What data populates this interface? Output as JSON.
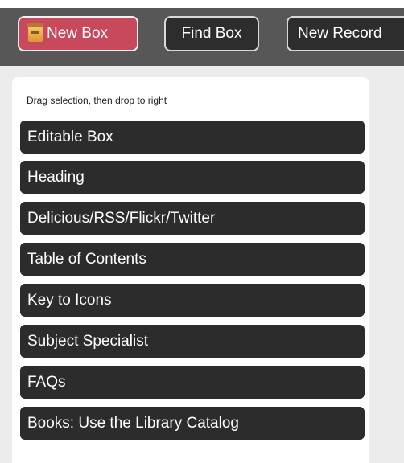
{
  "toolbar": {
    "new_box_label": "New Box",
    "new_box_icon": "box-icon",
    "find_box_label": "Find Box",
    "new_record_label": "New Record"
  },
  "panel": {
    "hint": "Drag selection, then drop to right",
    "items": [
      {
        "label": "Editable Box"
      },
      {
        "label": "Heading"
      },
      {
        "label": "Delicious/RSS/Flickr/Twitter"
      },
      {
        "label": "Table of Contents"
      },
      {
        "label": "Key to Icons"
      },
      {
        "label": "Subject Specialist"
      },
      {
        "label": "FAQs"
      },
      {
        "label": "Books: Use the Library Catalog"
      }
    ]
  },
  "colors": {
    "toolbar_bg": "#575757",
    "primary_button": "#c8485c",
    "item_bg": "#2c2c2c",
    "page_bg": "#ececec"
  }
}
